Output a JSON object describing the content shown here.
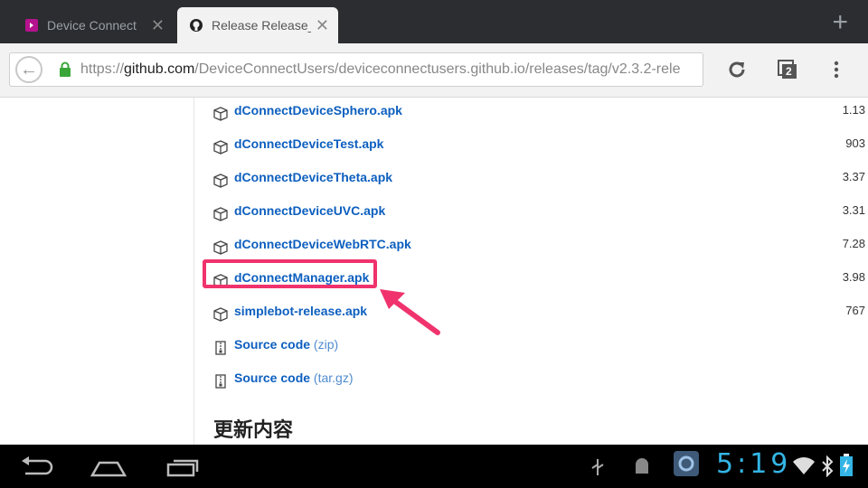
{
  "tabs": [
    {
      "title": "Device Connect",
      "active": false
    },
    {
      "title": "Release Release_",
      "active": true
    }
  ],
  "address_bar": {
    "scheme": "https://",
    "host": "github.com",
    "path": "/DeviceConnectUsers/deviceconnectusers.github.io/releases/tag/v2.3.2-rele"
  },
  "tab_count": "2",
  "assets": [
    {
      "name": "dConnectDeviceSphero.apk",
      "size": "1.13",
      "icon": "package-icon"
    },
    {
      "name": "dConnectDeviceTest.apk",
      "size": "903",
      "icon": "package-icon"
    },
    {
      "name": "dConnectDeviceTheta.apk",
      "size": "3.37",
      "icon": "package-icon"
    },
    {
      "name": "dConnectDeviceUVC.apk",
      "size": "3.31",
      "icon": "package-icon"
    },
    {
      "name": "dConnectDeviceWebRTC.apk",
      "size": "7.28",
      "icon": "package-icon"
    },
    {
      "name": "dConnectManager.apk",
      "size": "3.98",
      "icon": "package-icon"
    },
    {
      "name": "simplebot-release.apk",
      "size": "767",
      "icon": "package-icon"
    }
  ],
  "source_links": [
    {
      "label": "Source code",
      "ext": "(zip)",
      "icon": "zip-icon"
    },
    {
      "label": "Source code",
      "ext": "(tar.gz)",
      "icon": "zip-icon"
    }
  ],
  "section_title": "更新内容",
  "status_bar": {
    "time": "5:19"
  },
  "colors": {
    "link": "#0d5fbf",
    "highlight": "#f0336d",
    "clock": "#33b5e5"
  }
}
